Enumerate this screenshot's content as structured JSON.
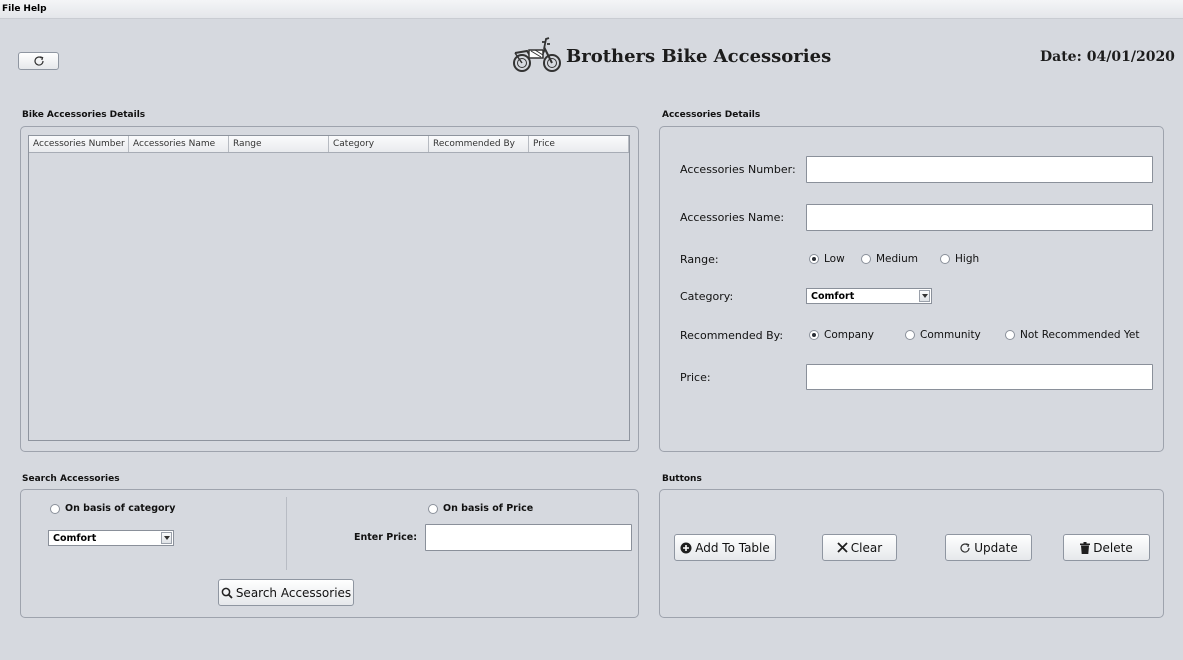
{
  "menu": {
    "file": "File",
    "help": "Help"
  },
  "header": {
    "app_title": "Brothers Bike Accessories",
    "date_label": "Date:",
    "date_value": "04/01/2020",
    "logo_icon": "motorcycle-icon",
    "refresh_icon": "refresh-icon"
  },
  "table_panel": {
    "label": "Bike Accessories Details",
    "columns": [
      "Accessories Number",
      "Accessories Name",
      "Range",
      "Category",
      "Recommended By",
      "Price"
    ],
    "rows": []
  },
  "details_panel": {
    "label": "Accessories Details",
    "number_label": "Accessories Number:",
    "number_value": "",
    "name_label": "Accessories Name:",
    "name_value": "",
    "range_label": "Range:",
    "range_options": [
      "Low",
      "Medium",
      "High"
    ],
    "range_selected": "Low",
    "category_label": "Category:",
    "category_value": "Comfort",
    "recommended_label": "Recommended By:",
    "recommended_options": [
      "Company",
      "Community",
      "Not Recommended Yet"
    ],
    "recommended_selected": "Company",
    "price_label": "Price:",
    "price_value": ""
  },
  "search_panel": {
    "label": "Search Accessories",
    "by_category": "On  basis of category",
    "category_value": "Comfort",
    "by_price": "On basis of Price",
    "enter_price_label": "Enter Price:",
    "price_value": "",
    "search_button": "Search Accessories"
  },
  "buttons_panel": {
    "label": "Buttons",
    "add": "Add To Table",
    "clear": "Clear",
    "update": "Update",
    "delete": "Delete"
  }
}
